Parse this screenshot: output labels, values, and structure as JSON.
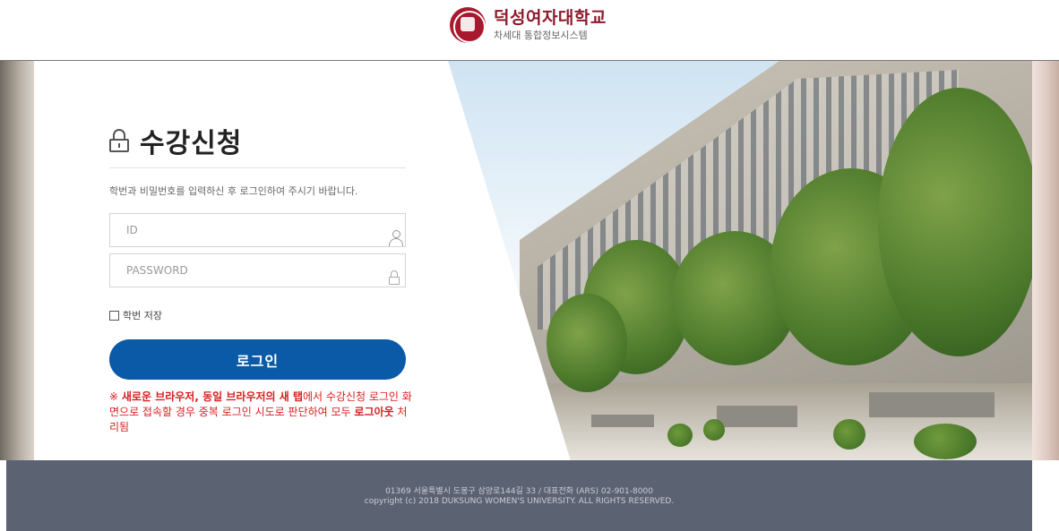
{
  "header": {
    "university_name": "덕성여자대학교",
    "system_name": "차세대 통합정보시스템"
  },
  "login": {
    "title": "수강신청",
    "instruction": "학번과 비밀번호를 입력하신 후 로그인하여 주시기 바랍니다.",
    "id_placeholder": "ID",
    "password_placeholder": "PASSWORD",
    "remember_label": "학번 저장",
    "remember_checked": false,
    "login_button": "로그인",
    "warning_prefix": "※",
    "warning_bold": "새로운 브라우저, 동일 브라우저의 새 탭",
    "warning_rest": "에서 수강신청 로그인 화면으로 접속할 경우 중복 로그인 시도로 판단하여 모두 ",
    "warning_bold2": "로그아웃",
    "warning_end": " 처리됨"
  },
  "footer": {
    "address": "01369 서울특별시 도봉구 삼양로144길 33 / 대표전화 (ARS) 02-901-8000",
    "copyright": "copyright (c) 2018 DUKSUNG WOMEN'S UNIVERSITY. ALL RIGHTS RESERVED."
  },
  "colors": {
    "brand": "#8e1a2a",
    "button": "#0a5aa8",
    "warning": "#d62020",
    "footer": "#5b6272"
  },
  "icons": [
    "university-seal-icon",
    "lock-icon",
    "user-icon",
    "password-lock-icon"
  ]
}
